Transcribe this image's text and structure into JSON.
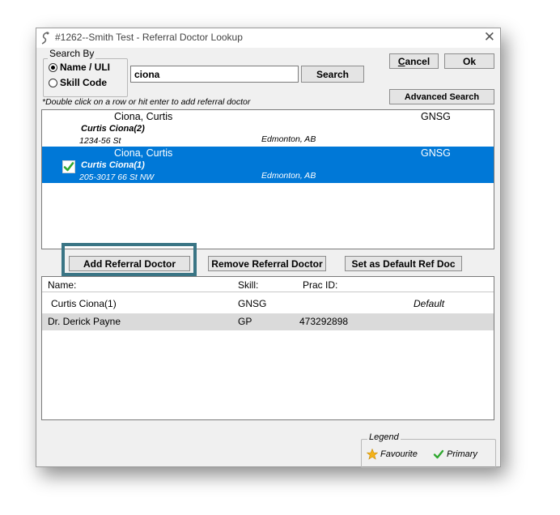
{
  "window": {
    "title": "#1262--Smith Test - Referral Doctor Lookup",
    "close_glyph": "✕"
  },
  "search_by": {
    "label": "Search By",
    "options": [
      {
        "label": "Name / ULI",
        "checked": true
      },
      {
        "label": "Skill Code",
        "checked": false
      }
    ]
  },
  "search": {
    "value": "ciona",
    "button": "Search"
  },
  "buttons": {
    "cancel_prefix": "C",
    "cancel_rest": "ancel",
    "ok": "Ok",
    "advanced": "Advanced Search"
  },
  "instruction": "*Double click on a row or hit enter to add referral doctor",
  "results": [
    {
      "name": "Ciona, Curtis",
      "skill": "GNSG",
      "sub": "Curtis Ciona(2)",
      "address": "1234-56 St",
      "city": "Edmonton, AB",
      "selected": false,
      "primary": false
    },
    {
      "name": "Ciona, Curtis",
      "skill": "GNSG",
      "sub": "Curtis Ciona(1)",
      "address": "205-3017 66 St NW",
      "city": "Edmonton, AB",
      "selected": true,
      "primary": true
    }
  ],
  "actions": {
    "add": "Add Referral Doctor",
    "remove": "Remove Referral Doctor",
    "set_default": "Set as Default Ref Doc"
  },
  "referral_list": {
    "headers": {
      "name": "Name:",
      "skill": "Skill:",
      "prac_id": "Prac ID:"
    },
    "rows": [
      {
        "name": "Curtis Ciona(1)",
        "skill": "GNSG",
        "prac_id": "",
        "default": "Default"
      },
      {
        "name": "Dr. Derick Payne",
        "skill": "GP",
        "prac_id": "473292898",
        "default": ""
      }
    ]
  },
  "legend": {
    "label": "Legend",
    "favourite": "Favourite",
    "primary": "Primary"
  },
  "colors": {
    "selection": "#0078d7",
    "highlight_border": "#3a7585",
    "star": "#f3b21a",
    "check": "#2fa82f"
  },
  "icons": {
    "favourite": "star-icon",
    "primary": "check-icon"
  }
}
